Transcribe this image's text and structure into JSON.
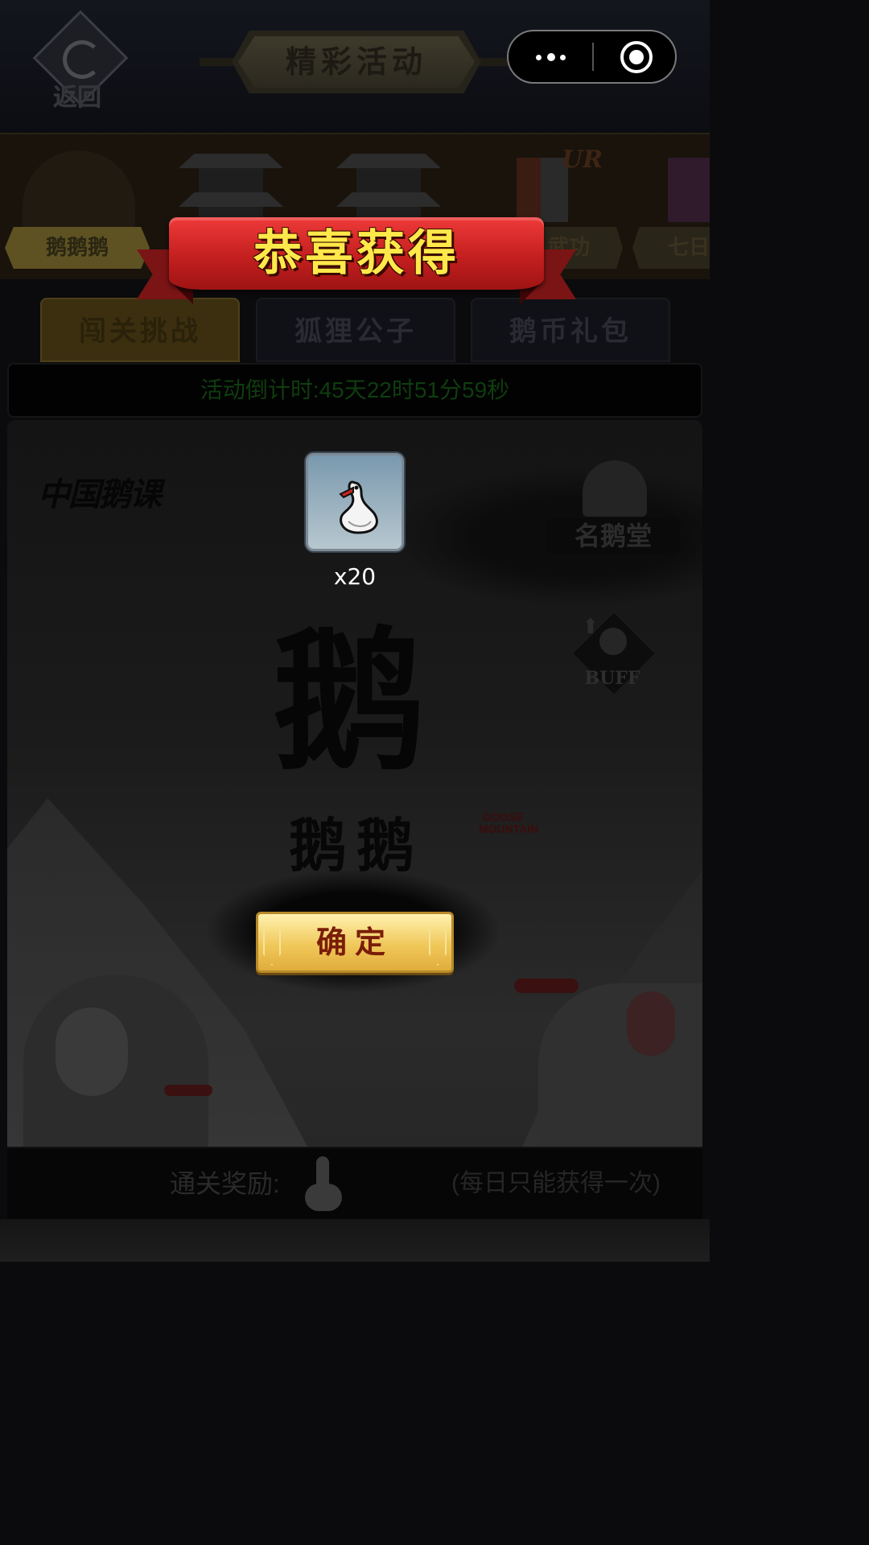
{
  "header": {
    "back_label": "返回",
    "title": "精彩活动"
  },
  "categories": [
    {
      "label": "鹅鹅鹅"
    },
    {
      "label": ""
    },
    {
      "label": ""
    },
    {
      "label": "武功",
      "badge": "UR"
    },
    {
      "label": "七日"
    }
  ],
  "tabs": [
    {
      "label": "闯关挑战",
      "selected": true
    },
    {
      "label": "狐狸公子",
      "selected": false
    },
    {
      "label": "鹅币礼包",
      "selected": false
    }
  ],
  "countdown": {
    "text": "活动倒计时:45天22时51分59秒"
  },
  "artwork": {
    "logo": "中国鹅课",
    "big_char": "鹅",
    "small_chars": "鹅鹅",
    "stamp": "GOOSE MOUNTAIN",
    "hall_label": "名鹅堂",
    "buff_label": "BUFF"
  },
  "footer": {
    "reward_label": "通关奖励:",
    "reward_note": "(每日只能获得一次)"
  },
  "modal": {
    "title": "恭喜获得",
    "item_icon": "goose-icon",
    "quantity": "x20",
    "confirm_label": "确定"
  },
  "colors": {
    "banner_red": "#c41f1f",
    "banner_text": "#ffe94a",
    "confirm_gold": "#f0c85a",
    "countdown_green": "#0f3d0f"
  }
}
